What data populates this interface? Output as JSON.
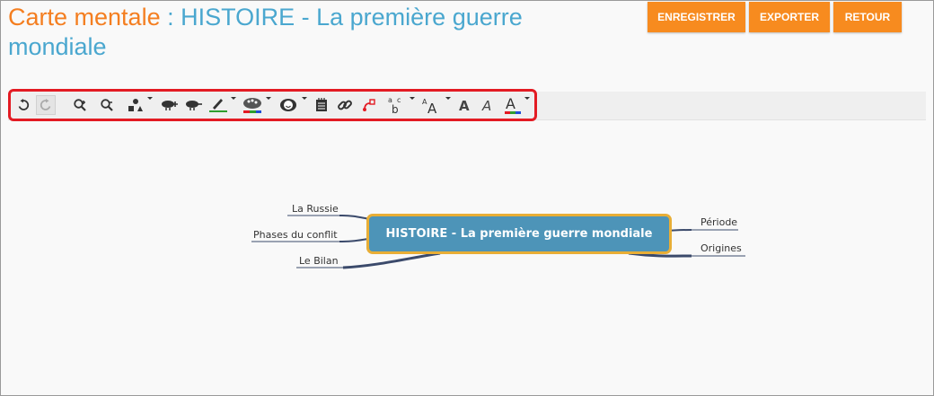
{
  "header": {
    "title_prefix": "Carte mentale",
    "title_rest": " : HISTOIRE - La première guerre mondiale",
    "prefix_color": "#f47e20",
    "title_color": "#4aa7cf"
  },
  "actions": {
    "save_label": "ENREGISTRER",
    "export_label": "EXPORTER",
    "back_label": "RETOUR",
    "button_color": "#f78b1f"
  },
  "toolbar": {
    "highlight_color": "#e31b23",
    "tools": [
      {
        "name": "undo-icon"
      },
      {
        "name": "redo-icon"
      },
      {
        "name": "zoom-in-icon"
      },
      {
        "name": "zoom-out-icon"
      },
      {
        "name": "shapes-icon"
      },
      {
        "name": "add-topic-icon"
      },
      {
        "name": "remove-topic-icon"
      },
      {
        "name": "line-color-icon"
      },
      {
        "name": "fill-color-icon"
      },
      {
        "name": "emoticon-icon"
      },
      {
        "name": "note-icon"
      },
      {
        "name": "link-icon"
      },
      {
        "name": "relationship-icon"
      },
      {
        "name": "text-case-icon"
      },
      {
        "name": "font-size-icon"
      },
      {
        "name": "bold-icon"
      },
      {
        "name": "italic-icon"
      },
      {
        "name": "font-color-icon"
      }
    ]
  },
  "mindmap": {
    "central": "HISTOIRE - La première guerre mondiale",
    "left_topics": [
      "La Russie",
      "Phases du conflit",
      "Le Bilan"
    ],
    "right_topics": [
      "Période",
      "Origines"
    ],
    "central_fill": "#4d94b8",
    "central_border": "#e8ae36",
    "branch_color": "#3b4a6b"
  }
}
